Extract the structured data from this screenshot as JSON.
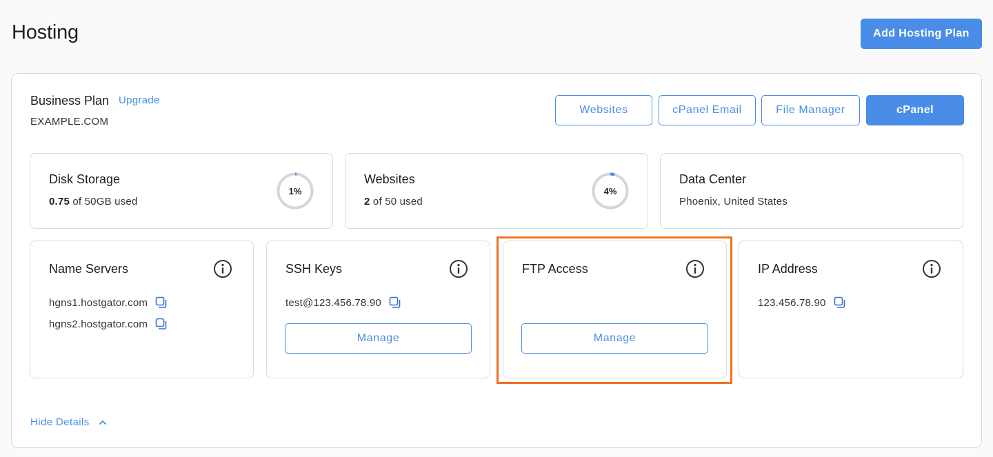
{
  "header": {
    "title": "Hosting",
    "add_plan_label": "Add Hosting Plan"
  },
  "plan": {
    "name": "Business Plan",
    "upgrade_label": "Upgrade",
    "domain": "EXAMPLE.COM",
    "buttons": {
      "websites": "Websites",
      "cpanel_email": "cPanel Email",
      "file_manager": "File Manager",
      "cpanel": "cPanel"
    }
  },
  "stats": {
    "disk": {
      "title": "Disk Storage",
      "used": "0.75",
      "rest": " of 50GB used",
      "percent_label": "1%",
      "percent": 1
    },
    "websites": {
      "title": "Websites",
      "used": "2",
      "rest": " of 50 used",
      "percent_label": "4%",
      "percent": 4
    },
    "datacenter": {
      "title": "Data Center",
      "location": "Phoenix, United States"
    }
  },
  "details": {
    "nameservers": {
      "title": "Name Servers",
      "ns1": "hgns1.hostgator.com",
      "ns2": "hgns2.hostgator.com"
    },
    "ssh": {
      "title": "SSH Keys",
      "key": "test@123.456.78.90",
      "manage_label": "Manage"
    },
    "ftp": {
      "title": "FTP Access",
      "manage_label": "Manage"
    },
    "ip": {
      "title": "IP Address",
      "value": "123.456.78.90"
    }
  },
  "footer": {
    "hide_details_label": "Hide Details"
  },
  "colors": {
    "accent": "#4a8de8",
    "highlight": "#ee7023",
    "ring_track": "#d6d6d6"
  }
}
